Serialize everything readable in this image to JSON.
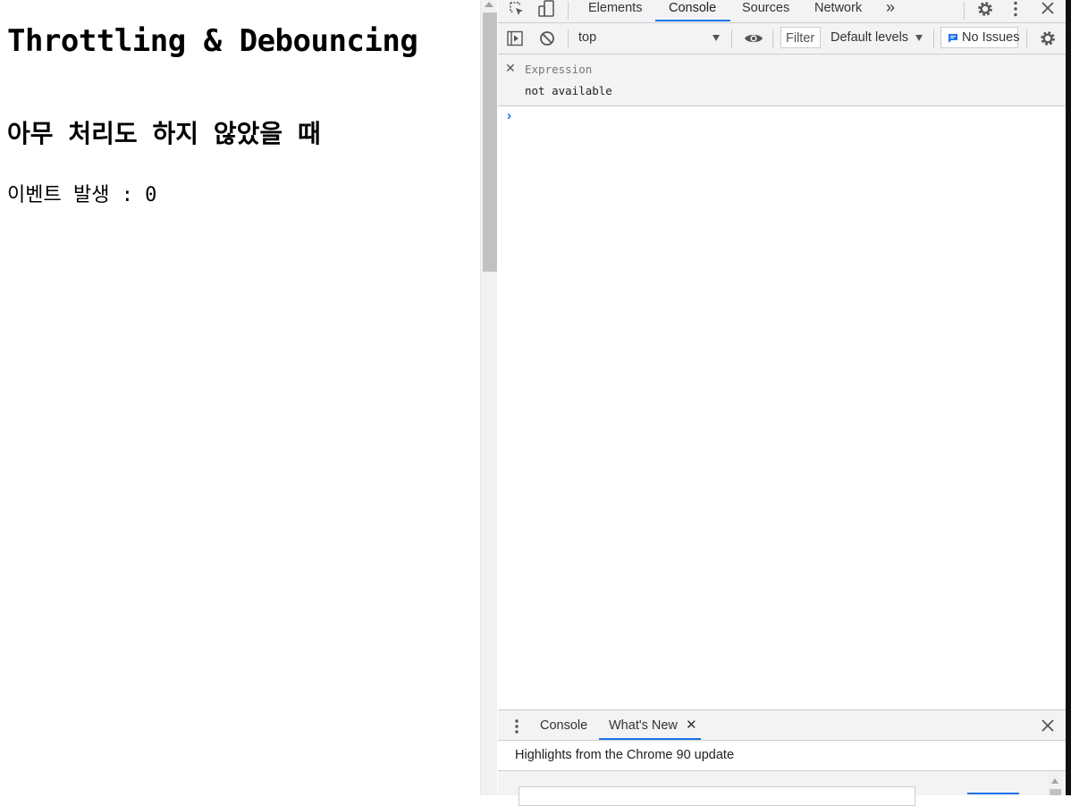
{
  "page": {
    "title": "Throttling & Debouncing",
    "subtitle": "아무 처리도 하지 않았을 때",
    "counter_text": "이벤트 발생 : 0"
  },
  "devtools": {
    "tabs": [
      "Elements",
      "Console",
      "Sources",
      "Network"
    ],
    "active_tab": "Console",
    "more_tabs_glyph": "»",
    "toolbar": {
      "context": "top",
      "filter_placeholder": "Filter",
      "levels": "Default levels",
      "issues": "No Issues"
    },
    "expression": {
      "name": "Expression",
      "value": "not available"
    },
    "prompt_glyph": "›",
    "drawer": {
      "tabs": [
        "Console",
        "What's New"
      ],
      "active_tab": "What's New",
      "highlights": "Highlights from the Chrome 90 update"
    }
  },
  "colors": {
    "accent": "#1a73e8",
    "toolbar_bg": "#f3f3f3",
    "border": "#cbcdd1"
  },
  "icons": [
    "inspect-element-icon",
    "device-toolbar-icon",
    "settings-gear-icon",
    "kebab-menu-icon",
    "close-icon",
    "sidebar-toggle-icon",
    "clear-console-icon",
    "eye-icon",
    "issue-flag-icon"
  ]
}
